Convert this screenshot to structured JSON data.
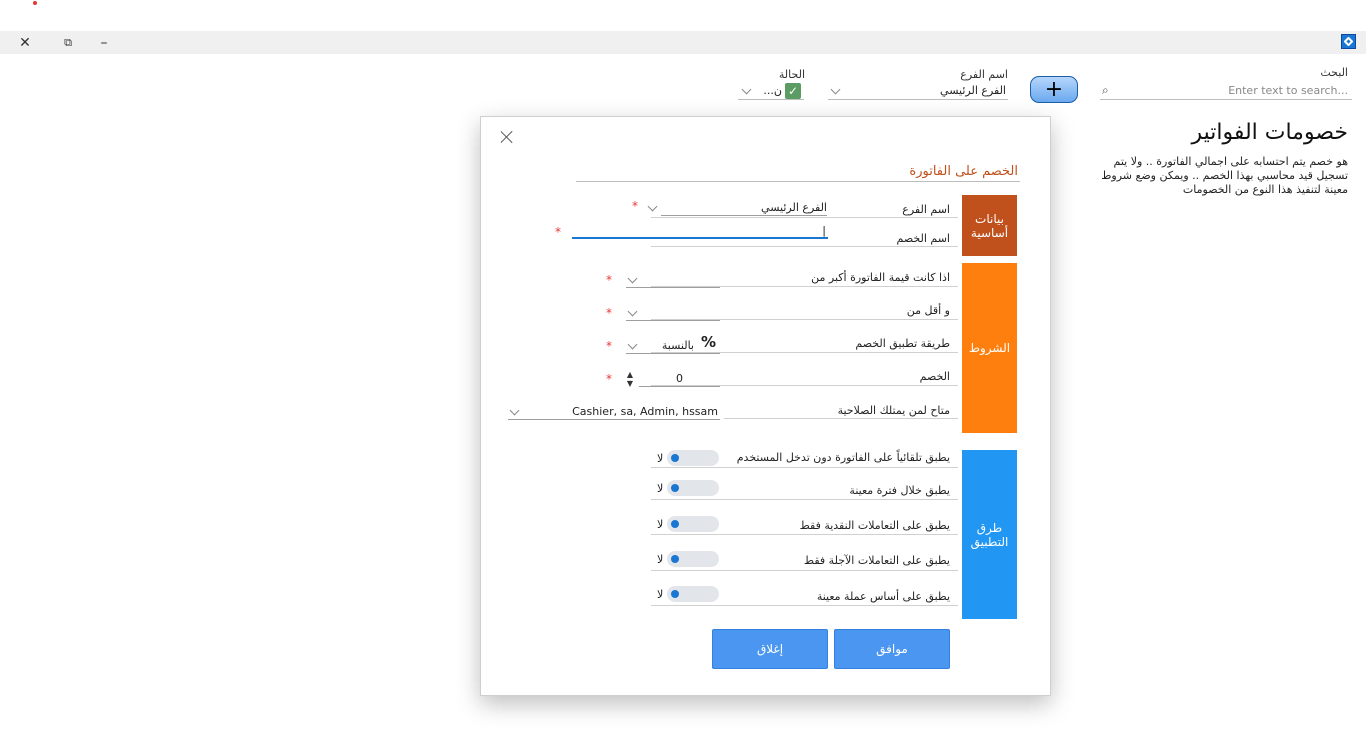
{
  "window": {
    "close_icon": "close-icon",
    "restore_icon": "restore-icon",
    "minimize_icon": "minimize-icon"
  },
  "toolbar": {
    "search_label": "البحث",
    "search_placeholder": "...Enter text to search",
    "branch_label": "اسم الفرع",
    "branch_value": "الفرع الرئيسي",
    "status_label": "الحالة",
    "status_value": "ن..."
  },
  "page": {
    "title": "خصومات الفواتير",
    "description": "هو خصم يتم احتسابه على اجمالي الفاتورة .. ولا يتم تسجيل قيد محاسبي بهذا الخصم .. ويمكن وضع شروط معينة لتنفيذ هذا النوع من الخصومات"
  },
  "dialog": {
    "title": "الخصم على الفاتورة",
    "sections": {
      "basic": "بيانات أساسية",
      "conditions": "الشروط",
      "methods": "طرق التطبيق"
    },
    "fields": {
      "branch_label": "اسم الفرع",
      "branch_value": "الفرع الرئيسي",
      "discount_name_label": "اسم الخصم",
      "discount_name_value": "|",
      "greater_than_label": "اذا كانت قيمة الفاتورة  أكبر من",
      "less_than_label": "و أقل من",
      "method_label": "طريقة تطبيق الخصم",
      "method_value": "بالنسبة",
      "method_symbol": "%",
      "discount_label": "الخصم",
      "discount_value": "0",
      "roles_label": "متاح لمن يمتلك الصلاحية",
      "roles_value": "Cashier, sa, Admin, hssam"
    },
    "required_mark": "*",
    "toggles": [
      {
        "label": "يطبق تلقائياً على الفاتورة دون تدخل المستخدم",
        "value": "لا"
      },
      {
        "label": "يطبق خلال فترة معينة",
        "value": "لا"
      },
      {
        "label": "يطبق على التعاملات النقدية فقط",
        "value": "لا"
      },
      {
        "label": "يطبق على التعاملات الآجلة فقط",
        "value": "لا"
      },
      {
        "label": "يطبق على أساس عملة معينة",
        "value": "لا"
      }
    ],
    "ok_label": "موافق",
    "close_label": "إغلاق"
  },
  "colors": {
    "basic": "#c0501c",
    "conditions": "#ff7f0e",
    "methods": "#2196f3",
    "button": "#4a96f0"
  }
}
